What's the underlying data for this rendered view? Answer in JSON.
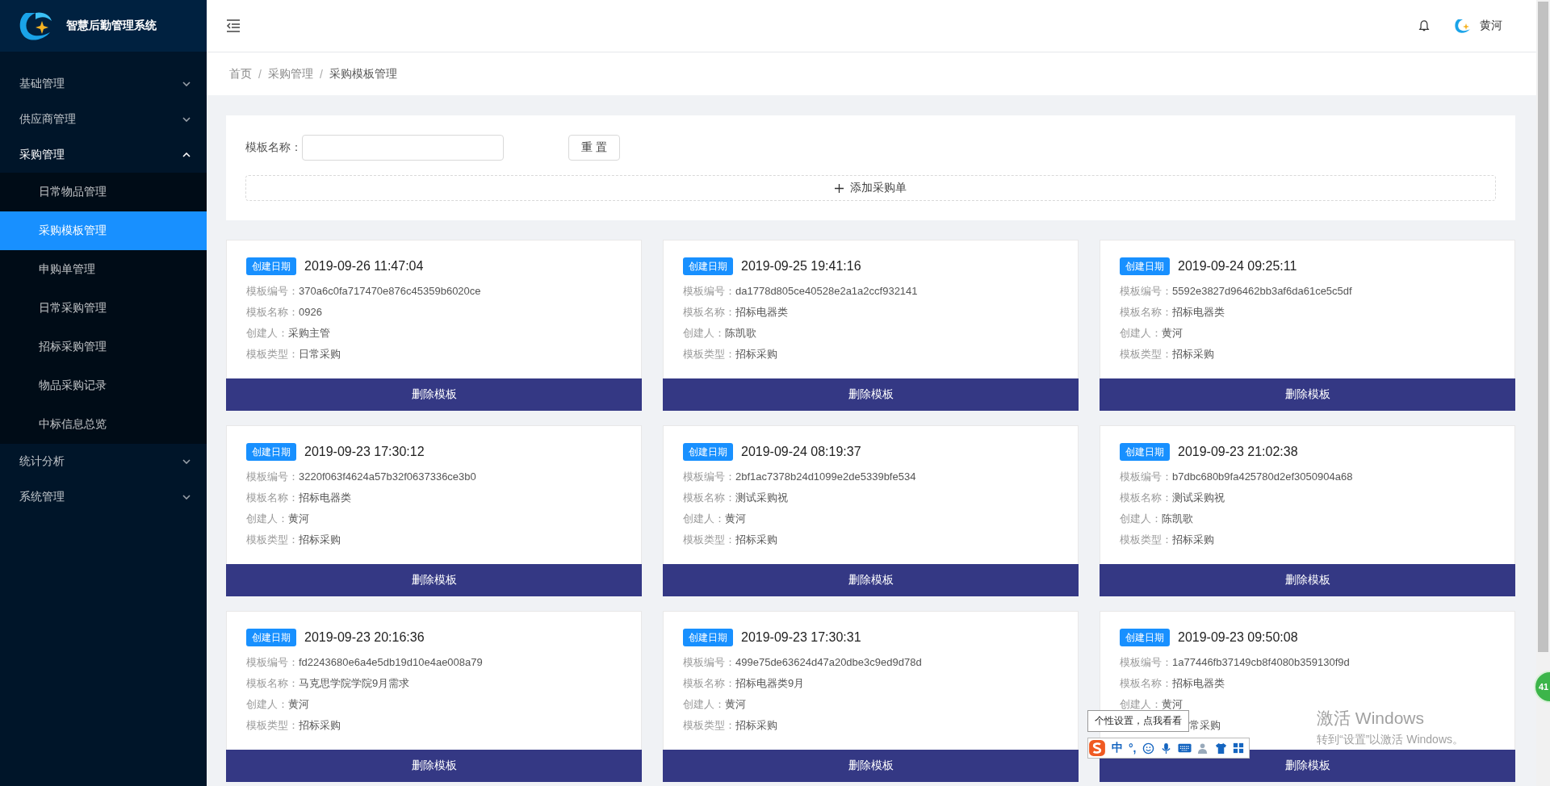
{
  "app": {
    "title": "智慧后勤管理系统"
  },
  "sidebar": {
    "items": [
      {
        "label": "基础管理",
        "expanded": false
      },
      {
        "label": "供应商管理",
        "expanded": false
      },
      {
        "label": "采购管理",
        "expanded": true,
        "children": [
          {
            "label": "日常物品管理",
            "selected": false
          },
          {
            "label": "采购模板管理",
            "selected": true
          },
          {
            "label": "申购单管理",
            "selected": false
          },
          {
            "label": "日常采购管理",
            "selected": false
          },
          {
            "label": "招标采购管理",
            "selected": false
          },
          {
            "label": "物品采购记录",
            "selected": false
          },
          {
            "label": "中标信息总览",
            "selected": false
          }
        ]
      },
      {
        "label": "统计分析",
        "expanded": false
      },
      {
        "label": "系统管理",
        "expanded": false
      }
    ]
  },
  "header": {
    "user": "黄河"
  },
  "breadcrumb": {
    "separator": "/",
    "items": [
      "首页",
      "采购管理",
      "采购模板管理"
    ]
  },
  "filter": {
    "label": "模板名称：",
    "reset_button": "重 置",
    "add_button": "添加采购单"
  },
  "cards": [
    {
      "tag": "创建日期",
      "date": "2019-09-26 11:47:04",
      "fields": [
        {
          "label": "模板编号：",
          "value": "370a6c0fa717470e876c45359b6020ce"
        },
        {
          "label": "模板名称：",
          "value": "0926"
        },
        {
          "label": "创建人：",
          "value": "采购主管"
        },
        {
          "label": "模板类型：",
          "value": "日常采购"
        }
      ],
      "button": "删除模板"
    },
    {
      "tag": "创建日期",
      "date": "2019-09-25 19:41:16",
      "fields": [
        {
          "label": "模板编号：",
          "value": "da1778d805ce40528e2a1a2ccf932141"
        },
        {
          "label": "模板名称：",
          "value": "招标电器类"
        },
        {
          "label": "创建人：",
          "value": "陈凯歌"
        },
        {
          "label": "模板类型：",
          "value": "招标采购"
        }
      ],
      "button": "删除模板"
    },
    {
      "tag": "创建日期",
      "date": "2019-09-24 09:25:11",
      "fields": [
        {
          "label": "模板编号：",
          "value": "5592e3827d96462bb3af6da61ce5c5df"
        },
        {
          "label": "模板名称：",
          "value": "招标电器类"
        },
        {
          "label": "创建人：",
          "value": "黄河"
        },
        {
          "label": "模板类型：",
          "value": "招标采购"
        }
      ],
      "button": "删除模板"
    },
    {
      "tag": "创建日期",
      "date": "2019-09-23 17:30:12",
      "fields": [
        {
          "label": "模板编号：",
          "value": "3220f063f4624a57b32f0637336ce3b0"
        },
        {
          "label": "模板名称：",
          "value": "招标电器类"
        },
        {
          "label": "创建人：",
          "value": "黄河"
        },
        {
          "label": "模板类型：",
          "value": "招标采购"
        }
      ],
      "button": "删除模板"
    },
    {
      "tag": "创建日期",
      "date": "2019-09-24 08:19:37",
      "fields": [
        {
          "label": "模板编号：",
          "value": "2bf1ac7378b24d1099e2de5339bfe534"
        },
        {
          "label": "模板名称：",
          "value": "测试采购祝"
        },
        {
          "label": "创建人：",
          "value": "黄河"
        },
        {
          "label": "模板类型：",
          "value": "招标采购"
        }
      ],
      "button": "删除模板"
    },
    {
      "tag": "创建日期",
      "date": "2019-09-23 21:02:38",
      "fields": [
        {
          "label": "模板编号：",
          "value": "b7dbc680b9fa425780d2ef3050904a68"
        },
        {
          "label": "模板名称：",
          "value": "测试采购祝"
        },
        {
          "label": "创建人：",
          "value": "陈凯歌"
        },
        {
          "label": "模板类型：",
          "value": "招标采购"
        }
      ],
      "button": "删除模板"
    },
    {
      "tag": "创建日期",
      "date": "2019-09-23 20:16:36",
      "fields": [
        {
          "label": "模板编号：",
          "value": "fd2243680e6a4e5db19d10e4ae008a79"
        },
        {
          "label": "模板名称：",
          "value": "马克思学院学院9月需求"
        },
        {
          "label": "创建人：",
          "value": "黄河"
        },
        {
          "label": "模板类型：",
          "value": "招标采购"
        }
      ],
      "button": "删除模板"
    },
    {
      "tag": "创建日期",
      "date": "2019-09-23 17:30:31",
      "fields": [
        {
          "label": "模板编号：",
          "value": "499e75de63624d47a20dbe3c9ed9d78d"
        },
        {
          "label": "模板名称：",
          "value": "招标电器类9月"
        },
        {
          "label": "创建人：",
          "value": "黄河"
        },
        {
          "label": "模板类型：",
          "value": "招标采购"
        }
      ],
      "button": "删除模板"
    },
    {
      "tag": "创建日期",
      "date": "2019-09-23 09:50:08",
      "fields": [
        {
          "label": "模板编号：",
          "value": "1a77446fb37149cb8f4080b359130f9d"
        },
        {
          "label": "模板名称：",
          "value": "招标电器类"
        },
        {
          "label": "创建人：",
          "value": "黄河"
        },
        {
          "value": "常采购"
        }
      ],
      "button": "删除模板"
    }
  ],
  "ime_toolbar": {
    "tooltip": "个性设置，点我看看",
    "mode": "中",
    "punctuation": "°,"
  },
  "floating_ball": {
    "count": "41"
  },
  "os_notice": {
    "title": "激活 Windows",
    "subtitle": "转到“设置”以激活 Windows。"
  }
}
